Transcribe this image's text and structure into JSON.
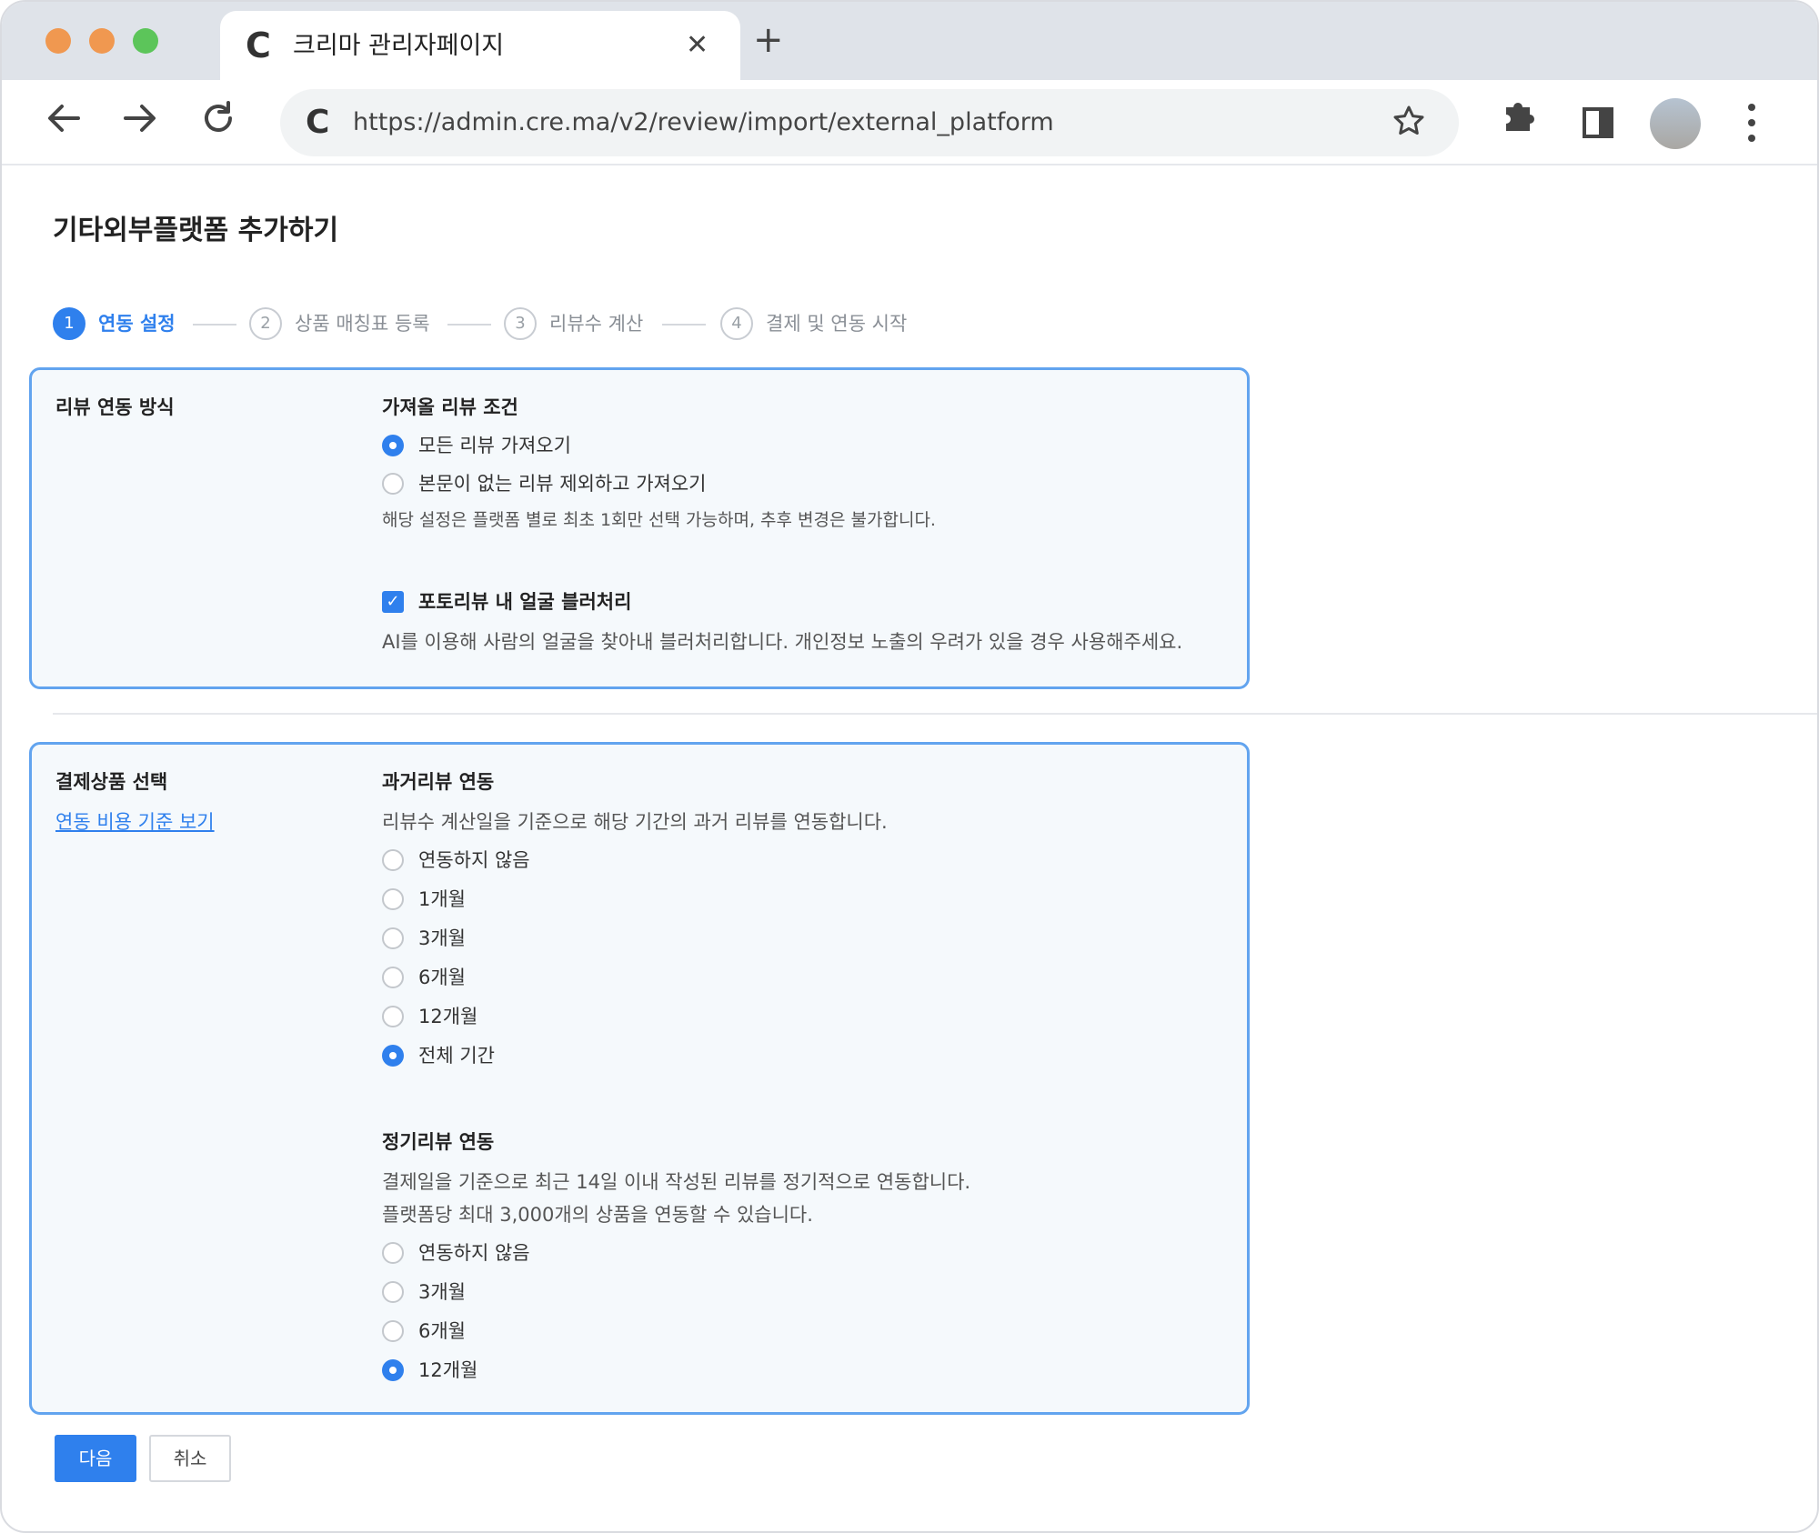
{
  "browser": {
    "tab_title": "크리마 관리자페이지",
    "tab_favicon": "C",
    "tab_close": "✕",
    "new_tab": "+",
    "url": "https://admin.cre.ma/v2/review/import/external_platform",
    "omnibox_favicon": "C",
    "icons": {
      "back": "back-arrow-icon",
      "forward": "forward-arrow-icon",
      "reload": "reload-icon",
      "bookmark": "star-icon",
      "extensions": "puzzle-icon",
      "side_panel": "side-panel-icon",
      "menu": "kebab-menu-icon"
    },
    "traffic_light_colors": [
      "#f09850",
      "#f09850",
      "#5cc55a"
    ]
  },
  "page": {
    "title": "기타외부플랫폼 추가하기",
    "accent_color": "#2f80ed",
    "steps": [
      {
        "num": "1",
        "label": "연동 설정",
        "active": true
      },
      {
        "num": "2",
        "label": "상품 매칭표 등록",
        "active": false
      },
      {
        "num": "3",
        "label": "리뷰수 계산",
        "active": false
      },
      {
        "num": "4",
        "label": "결제 및 연동 시작",
        "active": false
      }
    ]
  },
  "section1": {
    "label": "리뷰 연동 방식",
    "condition_title": "가져올 리뷰 조건",
    "options": [
      {
        "label": "모든 리뷰 가져오기",
        "checked": true
      },
      {
        "label": "본문이 없는 리뷰 제외하고 가져오기",
        "checked": false
      }
    ],
    "condition_note": "해당 설정은 플랫폼 별로 최초 1회만 선택 가능하며, 추후 변경은 불가합니다.",
    "blur_checkbox_label": "포토리뷰 내 얼굴 블러처리",
    "blur_checked": true,
    "blur_note": "AI를 이용해 사람의 얼굴을 찾아내 블러처리합니다. 개인정보 노출의 우려가 있을 경우 사용해주세요."
  },
  "section2": {
    "label": "결제상품 선택",
    "link": "연동 비용 기준 보기",
    "past": {
      "title": "과거리뷰 연동",
      "desc": "리뷰수 계산일을 기준으로 해당 기간의 과거 리뷰를 연동합니다.",
      "options": [
        {
          "label": "연동하지 않음",
          "checked": false
        },
        {
          "label": "1개월",
          "checked": false
        },
        {
          "label": "3개월",
          "checked": false
        },
        {
          "label": "6개월",
          "checked": false
        },
        {
          "label": "12개월",
          "checked": false
        },
        {
          "label": "전체 기간",
          "checked": true
        }
      ]
    },
    "regular": {
      "title": "정기리뷰 연동",
      "desc1": "결제일을 기준으로 최근 14일 이내 작성된 리뷰를 정기적으로 연동합니다.",
      "desc2": "플랫폼당 최대 3,000개의 상품을 연동할 수 있습니다.",
      "options": [
        {
          "label": "연동하지 않음",
          "checked": false
        },
        {
          "label": "3개월",
          "checked": false
        },
        {
          "label": "6개월",
          "checked": false
        },
        {
          "label": "12개월",
          "checked": true
        }
      ]
    }
  },
  "actions": {
    "next": "다음",
    "cancel": "취소"
  }
}
